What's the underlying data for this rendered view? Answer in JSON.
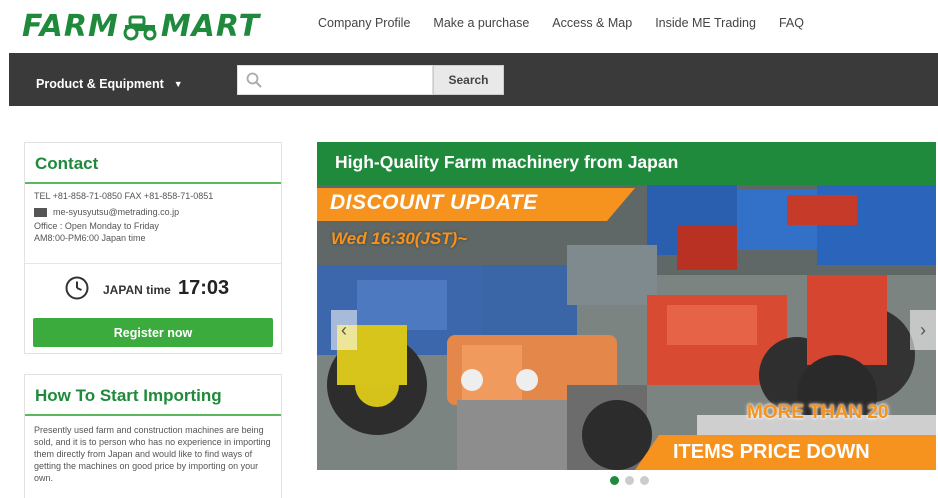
{
  "logo": {
    "left": "FARM",
    "right": "MART"
  },
  "topnav": [
    "Company Profile",
    "Make a purchase",
    "Access & Map",
    "Inside ME Trading",
    "FAQ"
  ],
  "toolbar": {
    "product_menu": "Product & Equipment",
    "search_placeholder": "",
    "search_button": "Search"
  },
  "contact": {
    "title": "Contact",
    "phone": "TEL +81-858-71-0850    FAX +81-858-71-0851",
    "email": "me-syusyutsu@metrading.co.jp",
    "hours_1": "Office : Open Monday to Friday",
    "hours_2": "AM8:00-PM6:00 Japan time",
    "time_label": "JAPAN time",
    "time_value": "17:03",
    "register": "Register now"
  },
  "howto": {
    "title": "How To Start Importing",
    "text": "Presently used farm and construction machines are being sold, and it is to person who has no experience in importing them directly from Japan and would like to find ways of getting the machines on good price by importing on your own."
  },
  "hero": {
    "title": "High-Quality Farm machinery from Japan",
    "discount": "DISCOUNT UPDATE",
    "date": "Wed 16:30(JST)~",
    "more": "MORE THAN 20",
    "items": "ITEMS PRICE DOWN",
    "prev": "‹",
    "next": "›"
  },
  "colors": {
    "brand_green": "#1f8a3c",
    "accent_orange": "#f6921e",
    "bar_dark": "#3a3a3a"
  },
  "carousel": {
    "slides": 3,
    "active": 1
  }
}
